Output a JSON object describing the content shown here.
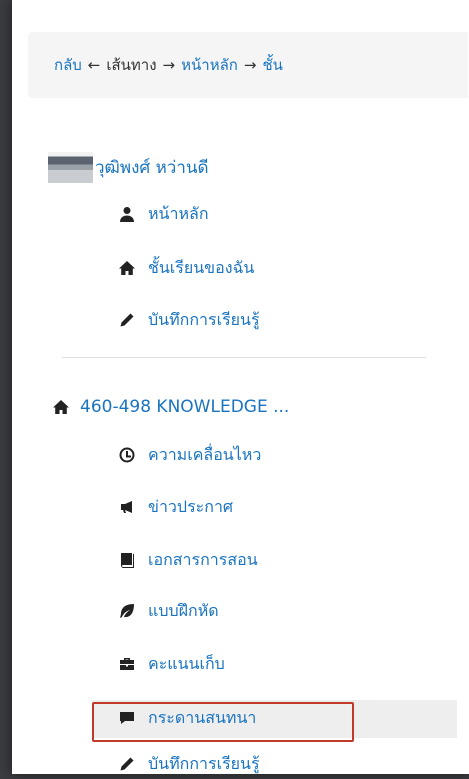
{
  "breadcrumb": {
    "items": [
      "กลับ",
      "เส้นทาง",
      "หน้าหลัก",
      "ชั้น"
    ],
    "separators": [
      "←",
      "→",
      "→"
    ]
  },
  "user": {
    "name": "วุฒิพงศ์ หว่านดี"
  },
  "user_menu": [
    {
      "label": "หน้าหลัก",
      "icon": "user-icon"
    },
    {
      "label": "ชั้นเรียนของฉัน",
      "icon": "home-icon"
    },
    {
      "label": "บันทึกการเรียนรู้",
      "icon": "pencil-icon"
    }
  ],
  "course": {
    "title": "460-498 KNOWLEDGE ...",
    "icon": "home-icon"
  },
  "course_menu": [
    {
      "label": "ความเคลื่อนไหว",
      "icon": "clock-icon"
    },
    {
      "label": "ข่าวประกาศ",
      "icon": "megaphone-icon"
    },
    {
      "label": "เอกสารการสอน",
      "icon": "book-icon"
    },
    {
      "label": "แบบฝึกหัด",
      "icon": "leaf-icon"
    },
    {
      "label": "คะแนนเก็บ",
      "icon": "briefcase-icon"
    },
    {
      "label": "กระดานสนทนา",
      "icon": "comment-icon",
      "highlighted": true
    },
    {
      "label": "บันทึกการเรียนรู้",
      "icon": "pencil-icon"
    }
  ],
  "colors": {
    "link": "#1a74c0",
    "highlight_border": "#c0392b"
  }
}
